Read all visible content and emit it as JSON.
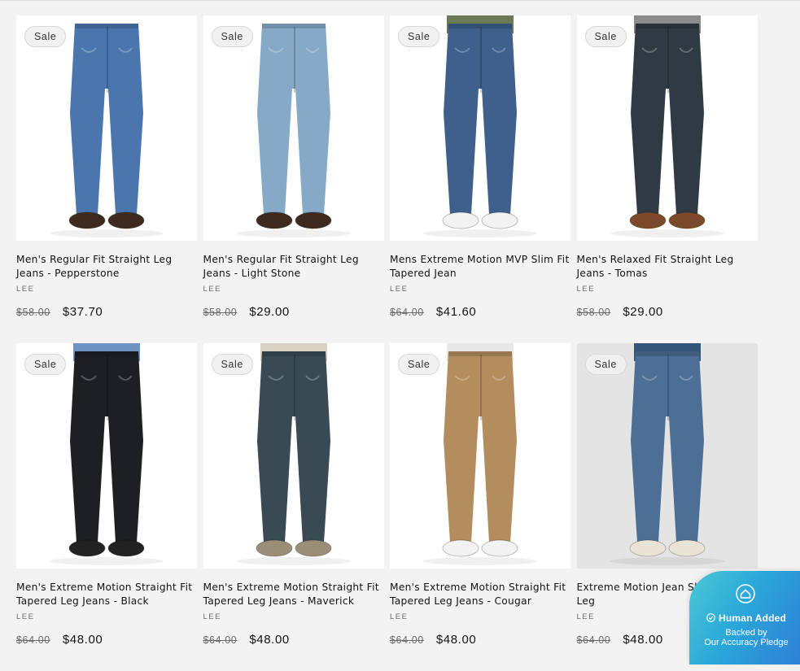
{
  "colors": {
    "background": "#f3f3f3",
    "text": "#121212",
    "muted": "#6a6a6a",
    "pledge_gradient": [
      "#4cc9d6",
      "#2f7ed6"
    ]
  },
  "products": [
    {
      "badge": "Sale",
      "title": "Men's Regular Fit Straight Leg Jeans - Pepperstone",
      "vendor": "LEE",
      "compare_price": "$58.00",
      "price": "$37.70",
      "denim": "#4a76ad",
      "shirt": "#ffffff",
      "shoe": "#3e2a1e"
    },
    {
      "badge": "Sale",
      "title": "Men's Regular Fit Straight Leg Jeans - Light Stone",
      "vendor": "LEE",
      "compare_price": "$58.00",
      "price": "$29.00",
      "denim": "#86a9c8",
      "shirt": "#ffffff",
      "shoe": "#3e2a1e"
    },
    {
      "badge": "Sale",
      "title": "Mens Extreme Motion MVP Slim Fit Tapered Jean",
      "vendor": "LEE",
      "compare_price": "$64.00",
      "price": "$41.60",
      "denim": "#3f5f8c",
      "shirt": "#6b7a55",
      "shoe": "#f2f2f2"
    },
    {
      "badge": "Sale",
      "title": "Men's Relaxed Fit Straight Leg Jeans - Tomas",
      "vendor": "LEE",
      "compare_price": "$58.00",
      "price": "$29.00",
      "denim": "#2f3a45",
      "shirt": "#8c8c8c",
      "shoe": "#7a4a2a"
    },
    {
      "badge": "Sale",
      "title": "Men's Extreme Motion Straight Fit Tapered Leg Jeans - Black",
      "vendor": "LEE",
      "compare_price": "$64.00",
      "price": "$48.00",
      "denim": "#1e1f23",
      "shirt": "#6f93c2",
      "shoe": "#222222"
    },
    {
      "badge": "Sale",
      "title": "Men's Extreme Motion Straight Fit Tapered Leg Jeans - Maverick",
      "vendor": "LEE",
      "compare_price": "$64.00",
      "price": "$48.00",
      "denim": "#3a4a55",
      "shirt": "#d9d2c2",
      "shoe": "#9a8e76"
    },
    {
      "badge": "Sale",
      "title": "Men's Extreme Motion Straight Fit Tapered Leg Jeans - Cougar",
      "vendor": "LEE",
      "compare_price": "$64.00",
      "price": "$48.00",
      "denim": "#b38d5e",
      "shirt": "#e8e8e8",
      "shoe": "#f2f2f2"
    },
    {
      "badge": "Sale",
      "title": "Extreme Motion Jean Slim Straight Leg",
      "vendor": "LEE",
      "compare_price": "$64.00",
      "price": "$48.00",
      "denim": "#4d6f96",
      "shirt": "#36557a",
      "shoe": "#e9e4d6",
      "gray_bg": true
    }
  ],
  "pledge": {
    "icon": "house-check-icon",
    "line1": "Human Added",
    "line2": "Backed by",
    "line3": "Our Accuracy Pledge"
  }
}
